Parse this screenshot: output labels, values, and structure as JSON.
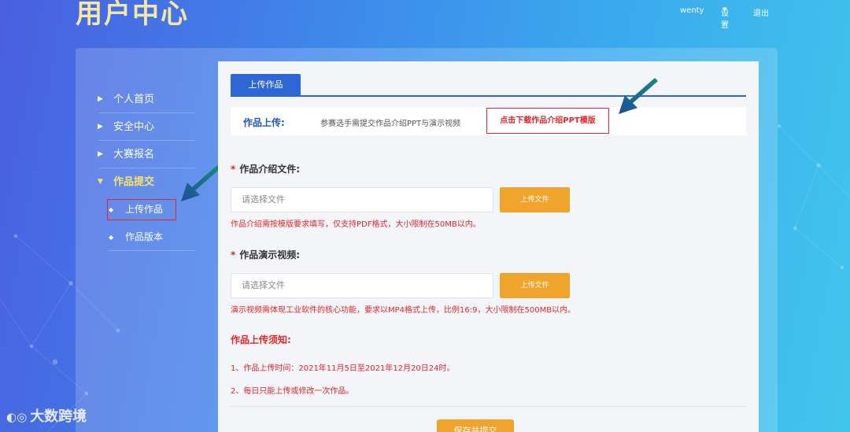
{
  "site": {
    "title": "用户中心"
  },
  "topnav": {
    "user": "wenty",
    "settings": "设置",
    "logout": "退出"
  },
  "sidebar": {
    "items": [
      {
        "label": "个人首页"
      },
      {
        "label": "安全中心"
      },
      {
        "label": "大赛报名"
      },
      {
        "label": "作品提交"
      }
    ],
    "subitems": [
      {
        "label": "上传作品"
      },
      {
        "label": "作品版本"
      }
    ]
  },
  "tab": {
    "label": "上传作品"
  },
  "notice": {
    "title": "作品上传:",
    "text": "参赛选手需提交作品介绍PPT与演示视频",
    "download_link": "点击下载作品介绍PPT模版"
  },
  "intro_file": {
    "required_mark": "*",
    "label": "作品介绍文件:",
    "placeholder": "请选择文件",
    "button": "上传文件",
    "hint": "作品介绍需按模版要求填写，仅支持PDF格式，大小限制在50MB以内。"
  },
  "demo_video": {
    "required_mark": "*",
    "label": "作品演示视频:",
    "placeholder": "请选择文件",
    "button": "上传文件",
    "hint": "演示视频需体现工业软件的核心功能，要求以MP4格式上传，比例16:9，大小限制在500MB以内。"
  },
  "rules": {
    "title": "作品上传须知:",
    "items": [
      "1、作品上传时间：2021年11月5日至2021年12月20日24时。",
      "2、每日只能上传或修改一次作品。"
    ]
  },
  "save_button": "保存并提交",
  "watermark": "大数跨境",
  "colors": {
    "primary": "#2d67d6",
    "accent": "#f1a42c",
    "alert": "#e0262b",
    "active_menu": "#f7e36a"
  },
  "icons": [
    "chevron-right-icon",
    "chevron-down-icon",
    "caret-down-icon",
    "bullet-icon",
    "pointer-arrow-icon"
  ]
}
